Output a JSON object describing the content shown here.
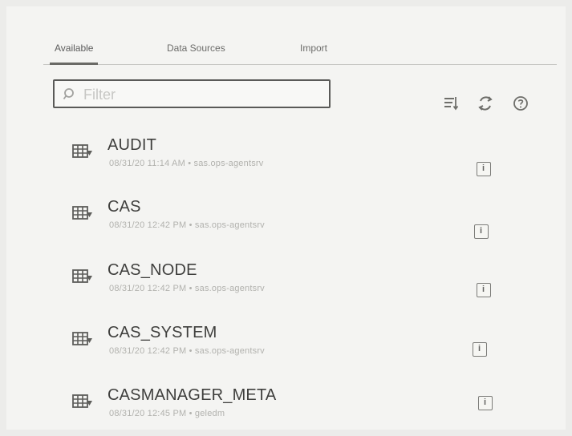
{
  "tabs": [
    {
      "label": "Available"
    },
    {
      "label": "Data Sources"
    },
    {
      "label": "Import"
    }
  ],
  "filter": {
    "placeholder": "Filter",
    "value": ""
  },
  "toolbar": {
    "icons": [
      "sort-icon",
      "refresh-icon",
      "help-icon"
    ]
  },
  "sources": [
    {
      "name": "AUDIT",
      "meta": "08/31/20 11:14 AM • sas.ops-agentsrv",
      "icon": "table-icon"
    },
    {
      "name": "CAS",
      "meta": "08/31/20 12:42 PM • sas.ops-agentsrv",
      "icon": "table-icon"
    },
    {
      "name": "CAS_NODE",
      "meta": "08/31/20 12:42 PM • sas.ops-agentsrv",
      "icon": "table-icon"
    },
    {
      "name": "CAS_SYSTEM",
      "meta": "08/31/20 12:42 PM • sas.ops-agentsrv",
      "icon": "table-icon"
    },
    {
      "name": "CASMANAGER_META",
      "meta": "08/31/20 12:45 PM • geledm",
      "icon": "table-icon"
    }
  ],
  "colors": {
    "background": "#ececea",
    "panel": "#f4f4f2",
    "text": "#3f3f3d",
    "muted": "#b2b2ae",
    "border": "#5a5a58"
  }
}
